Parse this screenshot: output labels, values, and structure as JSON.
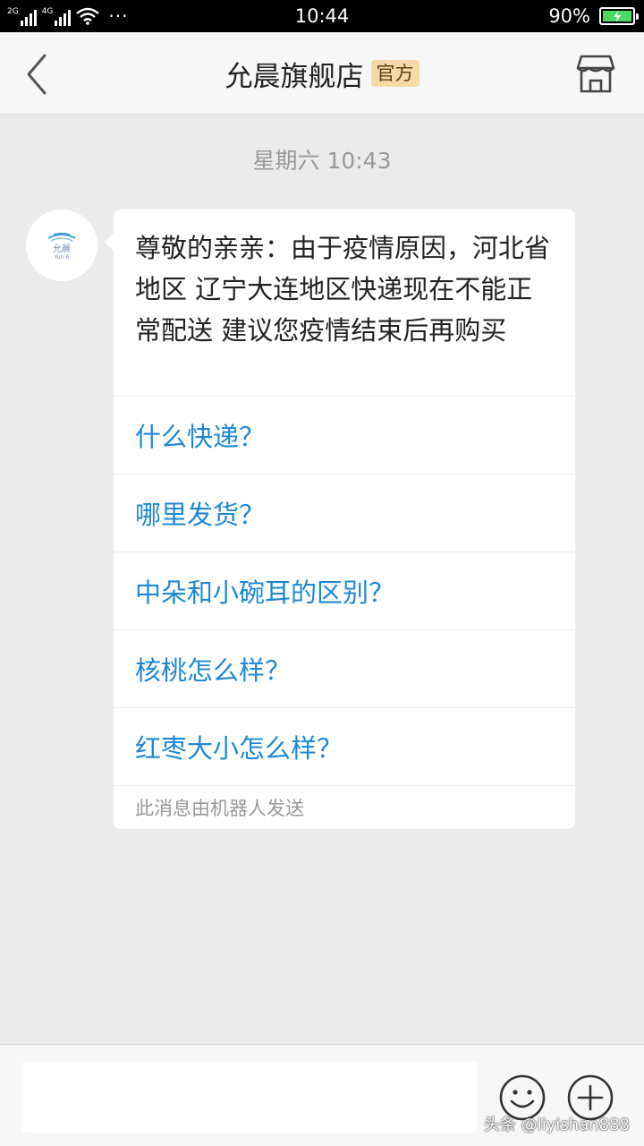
{
  "status_bar": {
    "net1": "2G",
    "net2": "4G",
    "dots": "···",
    "time": "10:44",
    "battery": "90%"
  },
  "header": {
    "title": "允晨旗舰店",
    "badge": "官方"
  },
  "chat": {
    "timestamp": "星期六 10:43",
    "avatar_text": "允晨",
    "avatar_sub": "Yun A",
    "message": "尊敬的亲亲：由于疫情原因，河北省地区 辽宁大连地区快递现在不能正常配送 建议您疫情结束后再购买",
    "quick_questions": [
      "什么快递？",
      "哪里发货？",
      "中朵和小碗耳的区别？",
      "核桃怎么样？",
      "红枣大小怎么样？"
    ],
    "robot_note": "此消息由机器人发送"
  },
  "watermark": "头条 @liyishan888",
  "colors": {
    "link_blue": "#1e88d6",
    "badge_bg": "#f7d9a8",
    "battery_green": "#4cd964"
  }
}
